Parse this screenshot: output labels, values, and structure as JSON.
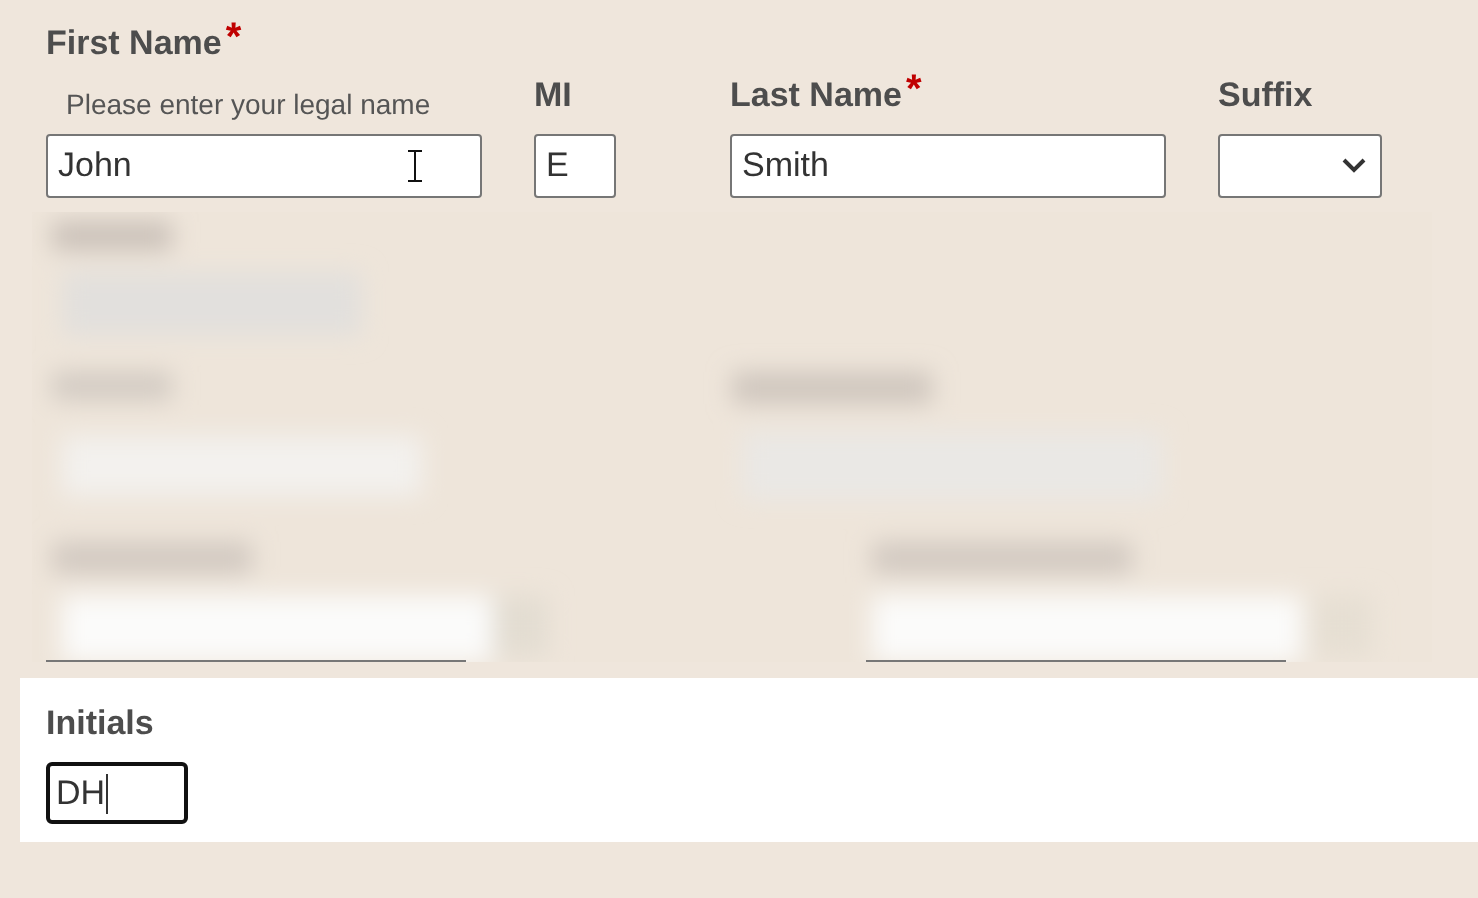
{
  "name_fields": [
    {
      "kind": "text",
      "label": "First Name",
      "required_mark": "*",
      "hint": "Please enter your legal name",
      "value": "John",
      "pointer": true
    },
    {
      "kind": "text",
      "label": "MI",
      "value": "E",
      "pointer": false
    },
    {
      "kind": "text",
      "label": "Last Name",
      "required_mark": "*",
      "value": "Smith",
      "pointer": false
    },
    {
      "kind": "select",
      "label": "Suffix",
      "pointer": false
    }
  ],
  "initials": {
    "label": "Initials",
    "value": "DH",
    "focused": true
  }
}
